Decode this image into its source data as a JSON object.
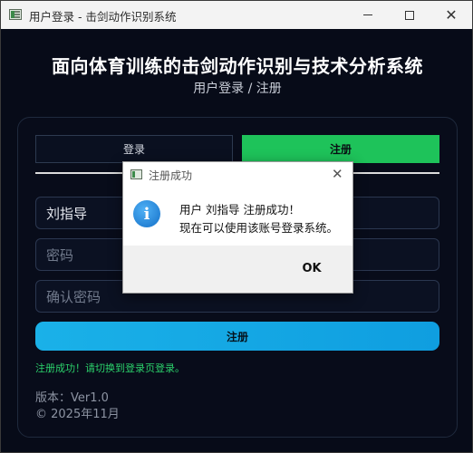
{
  "window": {
    "title": "用户登录 - 击剑动作识别系统",
    "minimize_glyph": "",
    "close_glyph": "✕"
  },
  "header": {
    "title": "面向体育训练的击剑动作识别与技术分析系统",
    "subtitle": "用户登录 / 注册"
  },
  "tabs": {
    "login": "登录",
    "register": "注册",
    "active": "register"
  },
  "form": {
    "username_value": "刘指导",
    "password_placeholder": "密码",
    "confirm_placeholder": "确认密码",
    "submit_label": "注册"
  },
  "status": {
    "message": "注册成功！请切换到登录页登录。"
  },
  "footer": {
    "version": "版本：Ver1.0",
    "copyright": "© 2025年11月"
  },
  "dialog": {
    "title": "注册成功",
    "close_glyph": "✕",
    "icon_glyph": "i",
    "message_line1": "用户 刘指导 注册成功！",
    "message_line2": "现在可以使用该账号登录系统。",
    "ok_label": "OK"
  },
  "colors": {
    "background": "#070b18",
    "accent_green": "#1ec35a",
    "accent_blue": "#1ab1e8",
    "status_green": "#2bd26b"
  }
}
